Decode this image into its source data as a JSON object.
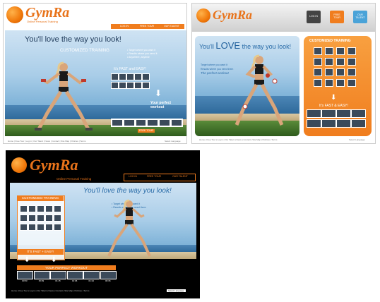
{
  "brand": {
    "name": "GymRa",
    "tagline": "Online Personal Training"
  },
  "v1": {
    "nav": [
      "LOG IN",
      "FREE TOUR",
      "OUR TALENT"
    ],
    "headline": "You'll love the way you look!",
    "subhead": "CUSTOMIZED TRAINING",
    "bullets": [
      "• Target where you want it",
      "• Results where you need it",
      "• Anywhere, anytime"
    ],
    "fast_easy": "It's FAST and EASY!",
    "perfect_workout": "Your perfect workout",
    "cta": "FREE TOUR",
    "footer": "Home | Free Tour | Log in | Our Talent | News | Contact | Site Map | Policies | Terms",
    "language": "Select Language"
  },
  "v2": {
    "nav": [
      "LOG IN",
      "FREE TOUR",
      "OUR TALENT"
    ],
    "headline_a": "You'll",
    "headline_b": "LOVE",
    "headline_c": "the way you look!",
    "bullets": [
      "Target where you want it",
      "Results where you need them",
      "The perfect workout"
    ],
    "side_title": "CUSTOMIZED TRAINING",
    "fast_easy": "It's FAST & EASY!",
    "footer": "Home | Free Tour | Log in | Our Talent | News | Contact | Site Map | Policies | Terms",
    "language": "Select Language"
  },
  "v3": {
    "nav": [
      "LOG IN",
      "FREE TOUR",
      "OUR TALENT"
    ],
    "headline": "You'll love the way you look!",
    "bullets": [
      "• Target where you want it",
      "• Results where you need them"
    ],
    "side_title": "CUSTOMIZED TRAINING",
    "fast_easy": "IT'S FAST + EASY!",
    "perfect_workout": "YOUR PERFECT WORKOUT",
    "thumb_labels": [
      "00:53",
      "15:09",
      "01:15",
      "01:36",
      "01:24",
      "00:36"
    ],
    "footer": "Home | Free Tour | Log in | Our Talent | News | Contact | Site Map | Policies | Terms",
    "language": "Select Language"
  }
}
